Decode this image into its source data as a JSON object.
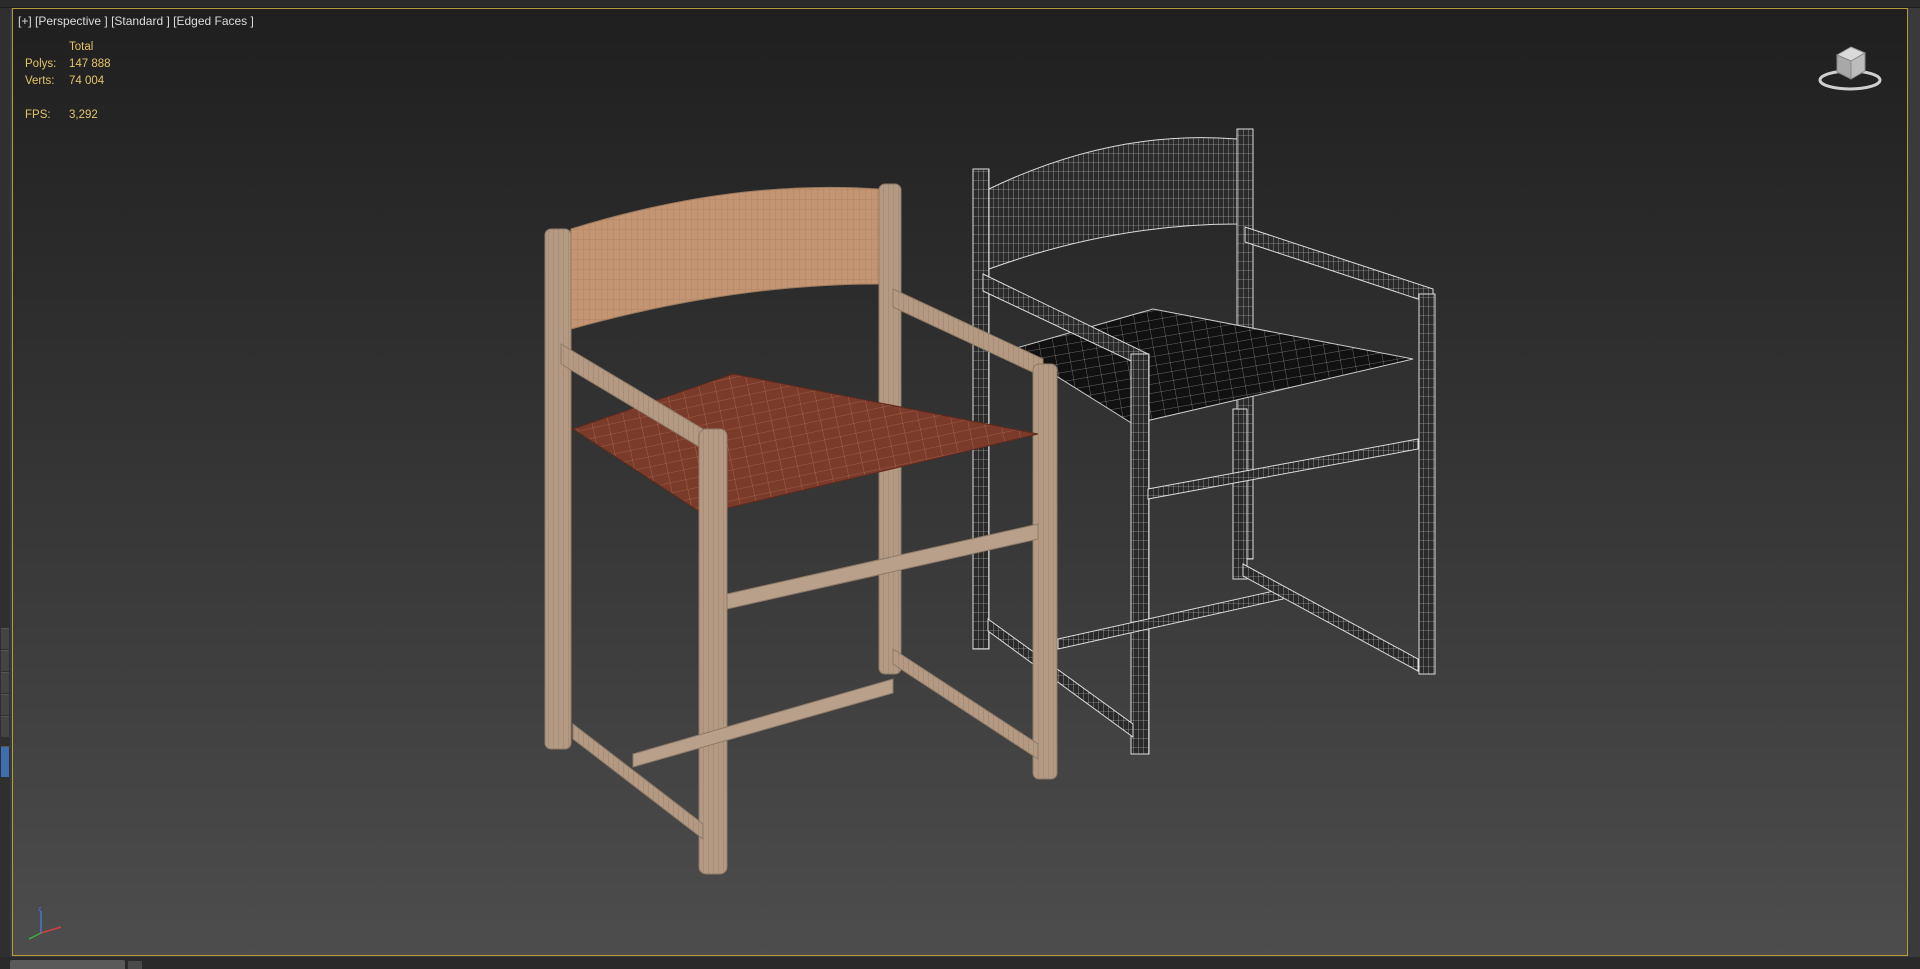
{
  "viewport": {
    "label_plus": "[+]",
    "label_view": "[Perspective ]",
    "label_shading": "[Standard ]",
    "label_mode": "[Edged Faces ]"
  },
  "stats": {
    "header": "Total",
    "polys_label": "Polys:",
    "polys_value": "147 888",
    "verts_label": "Verts:",
    "verts_value": "74 004",
    "fps_label": "FPS:",
    "fps_value": "3,292"
  },
  "colors": {
    "viewport_border": "#b49b3c",
    "stats_text": "#e2c56a",
    "wood": "#b49a83",
    "leather": "#7a3b2a",
    "wire": "#cfcfcf"
  },
  "icons": {
    "viewcube": "viewcube-icon",
    "axis_tripod": "axis-tripod-icon"
  }
}
